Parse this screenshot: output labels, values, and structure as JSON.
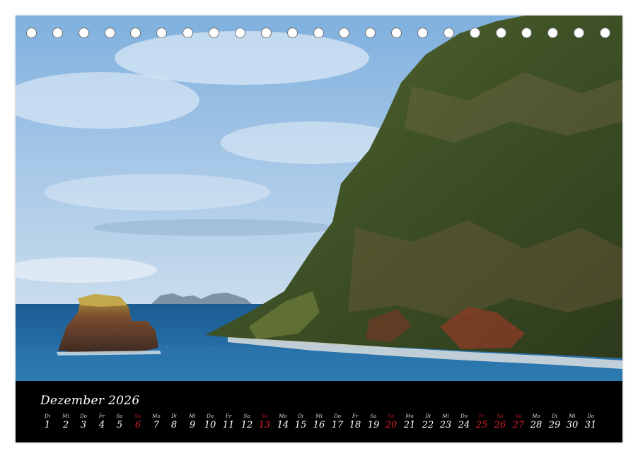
{
  "calendar": {
    "month_label": "Dezember 2026",
    "days": [
      {
        "wd": "Di",
        "dn": "1",
        "weekend": false
      },
      {
        "wd": "Mi",
        "dn": "2",
        "weekend": false
      },
      {
        "wd": "Do",
        "dn": "3",
        "weekend": false
      },
      {
        "wd": "Fr",
        "dn": "4",
        "weekend": false
      },
      {
        "wd": "Sa",
        "dn": "5",
        "weekend": false
      },
      {
        "wd": "So",
        "dn": "6",
        "weekend": true
      },
      {
        "wd": "Mo",
        "dn": "7",
        "weekend": false
      },
      {
        "wd": "Di",
        "dn": "8",
        "weekend": false
      },
      {
        "wd": "Mi",
        "dn": "9",
        "weekend": false
      },
      {
        "wd": "Do",
        "dn": "10",
        "weekend": false
      },
      {
        "wd": "Fr",
        "dn": "11",
        "weekend": false
      },
      {
        "wd": "Sa",
        "dn": "12",
        "weekend": false
      },
      {
        "wd": "So",
        "dn": "13",
        "weekend": true
      },
      {
        "wd": "Mo",
        "dn": "14",
        "weekend": false
      },
      {
        "wd": "Di",
        "dn": "15",
        "weekend": false
      },
      {
        "wd": "Mi",
        "dn": "16",
        "weekend": false
      },
      {
        "wd": "Do",
        "dn": "17",
        "weekend": false
      },
      {
        "wd": "Fr",
        "dn": "18",
        "weekend": false
      },
      {
        "wd": "Sa",
        "dn": "19",
        "weekend": false
      },
      {
        "wd": "So",
        "dn": "20",
        "weekend": true
      },
      {
        "wd": "Mo",
        "dn": "21",
        "weekend": false
      },
      {
        "wd": "Di",
        "dn": "22",
        "weekend": false
      },
      {
        "wd": "Mi",
        "dn": "23",
        "weekend": false
      },
      {
        "wd": "Do",
        "dn": "24",
        "weekend": false
      },
      {
        "wd": "Fr",
        "dn": "25",
        "weekend": true
      },
      {
        "wd": "Sa",
        "dn": "26",
        "weekend": true
      },
      {
        "wd": "So",
        "dn": "27",
        "weekend": true
      },
      {
        "wd": "Mo",
        "dn": "28",
        "weekend": false
      },
      {
        "wd": "Di",
        "dn": "29",
        "weekend": false
      },
      {
        "wd": "Mi",
        "dn": "30",
        "weekend": false
      },
      {
        "wd": "Do",
        "dn": "31",
        "weekend": false
      }
    ]
  },
  "binding": {
    "hole_count": 23
  },
  "colors": {
    "strip": "#000000",
    "text": "#ffffff",
    "holiday": "#e0232b",
    "sky": "#8fb9e3",
    "sea": "#1e5f95",
    "cliff": "#4a5a2a"
  }
}
